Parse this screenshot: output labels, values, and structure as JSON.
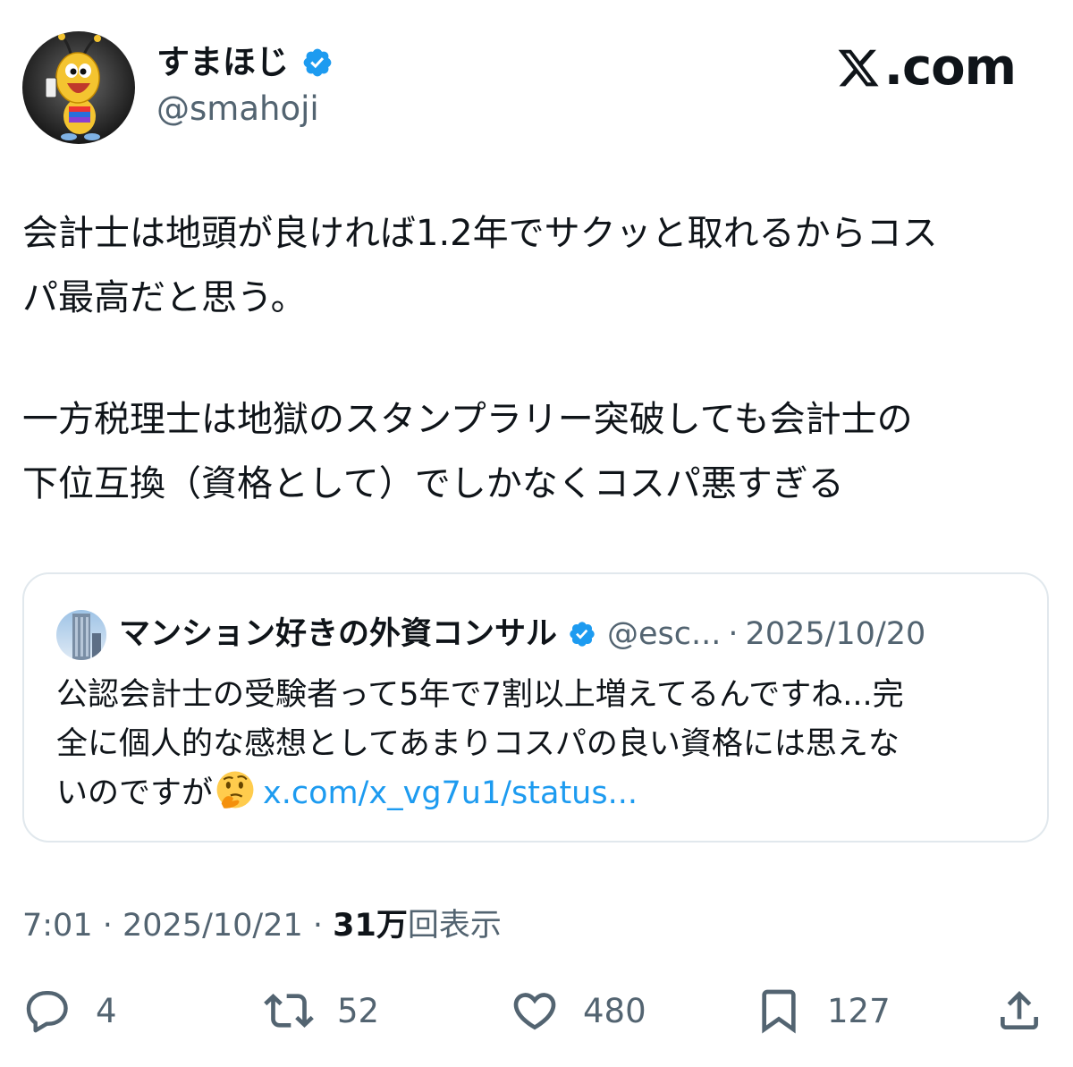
{
  "header": {
    "display_name": "すまほじ",
    "handle": "@smahoji",
    "site": ".com"
  },
  "tweet": {
    "lines": [
      "会計士は地頭が良ければ1.2年でサクッと取れるからコス",
      "パ最高だと思う。",
      "一方税理士は地獄のスタンプラリー突破しても会計士の",
      "下位互換（資格として）でしかなくコスパ悪すぎる"
    ]
  },
  "quote": {
    "name": "マンション好きの外資コンサル",
    "handle": "@esc...",
    "separator": "·",
    "date": "2025/10/20",
    "lines": [
      "公認会計士の受験者って5年で7割以上増えてるんですね...完",
      "全に個人的な感想としてあまりコスパの良い資格には思えな",
      "いのですが"
    ],
    "emoji": "thinking-face-icon",
    "link": "x.com/x_vg7u1/status..."
  },
  "meta": {
    "time": "7:01",
    "sep1": " · ",
    "date": "2025/10/21",
    "sep2": " · ",
    "views_number": "31万",
    "views_label": "回表示"
  },
  "actions": {
    "replies": "4",
    "reposts": "52",
    "likes": "480",
    "bookmarks": "127"
  },
  "colors": {
    "text": "#0f1419",
    "secondary": "#536471",
    "link": "#1d9bf0",
    "verified": "#1d9bf0",
    "border": "#e1e8ed"
  }
}
